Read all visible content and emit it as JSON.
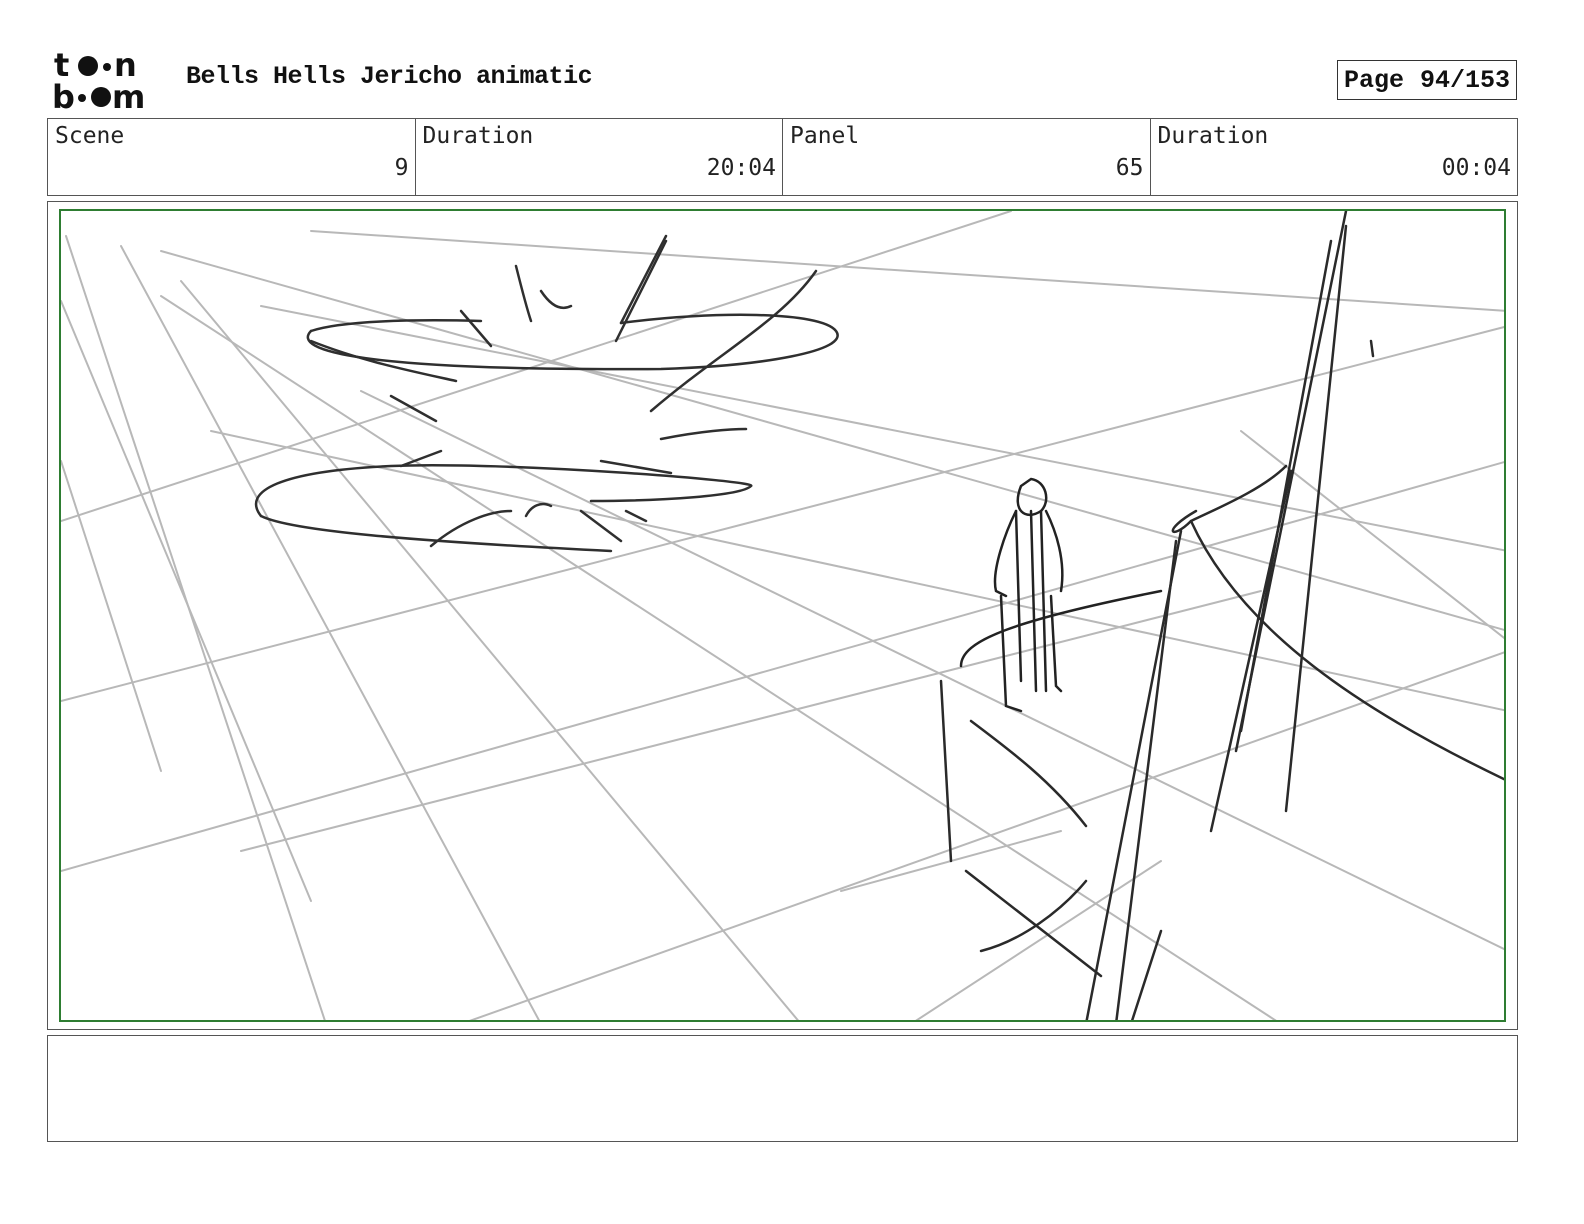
{
  "header": {
    "logo_name": "toon-boom-logo",
    "title": "Bells Hells Jericho animatic",
    "page_label": "Page",
    "page_value": "94/153"
  },
  "info": {
    "scene_label": "Scene",
    "scene_value": "9",
    "scene_duration_label": "Duration",
    "scene_duration_value": "20:04",
    "panel_label": "Panel",
    "panel_value": "65",
    "panel_duration_label": "Duration",
    "panel_duration_value": "00:04"
  },
  "colors": {
    "frame_border": "#2e7d32",
    "sketch_dark": "#333333",
    "sketch_light": "#b5b5b5"
  },
  "notes": {
    "text": ""
  }
}
